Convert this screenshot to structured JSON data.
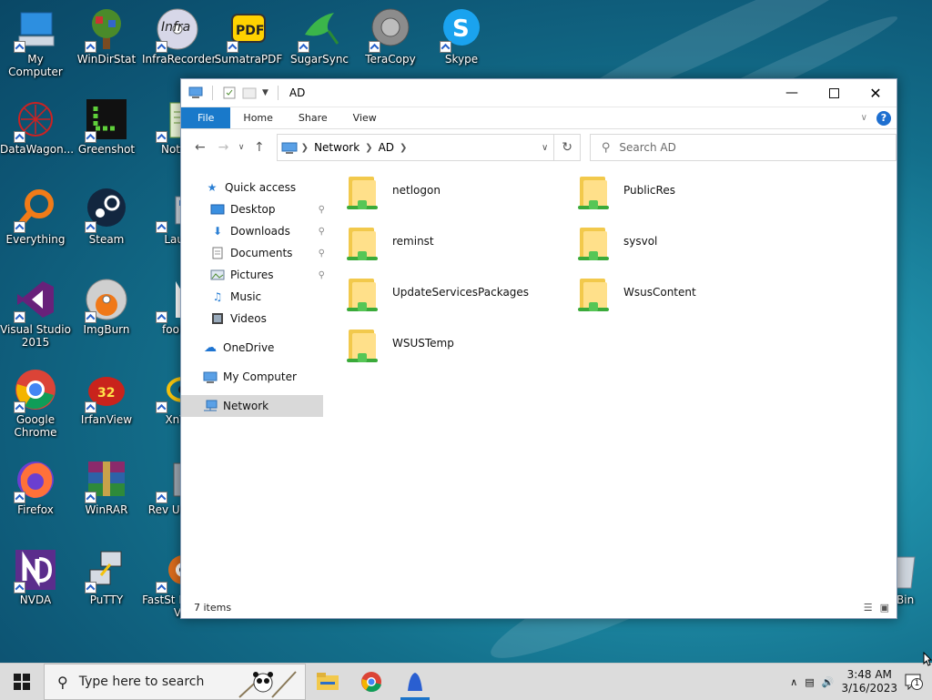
{
  "desktop": {
    "icons": [
      {
        "label": "My Computer"
      },
      {
        "label": "WinDirStat"
      },
      {
        "label": "InfraRecorder"
      },
      {
        "label": "SumatraPDF"
      },
      {
        "label": "SugarSync"
      },
      {
        "label": "TeraCopy"
      },
      {
        "label": "Skype"
      },
      {
        "label": "DataWagon..."
      },
      {
        "label": "Greenshot"
      },
      {
        "label": "Notep"
      },
      {
        "label": "Everything"
      },
      {
        "label": "Steam"
      },
      {
        "label": "Laun"
      },
      {
        "label": "Visual Studio 2015"
      },
      {
        "label": "ImgBurn"
      },
      {
        "label": "fooba"
      },
      {
        "label": "Google Chrome"
      },
      {
        "label": "IrfanView"
      },
      {
        "label": "XnVi"
      },
      {
        "label": "Firefox"
      },
      {
        "label": "WinRAR"
      },
      {
        "label": "Rev Uninst"
      },
      {
        "label": "NVDA"
      },
      {
        "label": "PuTTY"
      },
      {
        "label": "FastSt Image V"
      },
      {
        "label": "e Bin"
      }
    ],
    "irfanview_badge": "32",
    "sumatra_badge": "PDF",
    "skype_badge": "S",
    "infra_badge": "Infra"
  },
  "explorer": {
    "title": "AD",
    "ribbon_tabs": [
      "File",
      "Home",
      "Share",
      "View"
    ],
    "help": "?",
    "breadcrumb": [
      "Network",
      "AD"
    ],
    "search_placeholder": "Search AD",
    "nav": [
      {
        "label": "Quick access",
        "icon": "star-icon",
        "pinned": false
      },
      {
        "label": "Desktop",
        "icon": "desktop-icon",
        "pinned": true
      },
      {
        "label": "Downloads",
        "icon": "download-icon",
        "pinned": true
      },
      {
        "label": "Documents",
        "icon": "document-icon",
        "pinned": true
      },
      {
        "label": "Pictures",
        "icon": "picture-icon",
        "pinned": true
      },
      {
        "label": "Music",
        "icon": "music-icon",
        "pinned": false
      },
      {
        "label": "Videos",
        "icon": "video-icon",
        "pinned": false
      },
      {
        "label": "OneDrive",
        "icon": "cloud-icon",
        "pinned": false
      },
      {
        "label": "My Computer",
        "icon": "computer-icon",
        "pinned": false
      },
      {
        "label": "Network",
        "icon": "network-icon",
        "pinned": false,
        "selected": true
      }
    ],
    "items": [
      {
        "name": "netlogon"
      },
      {
        "name": "PublicRes"
      },
      {
        "name": "reminst"
      },
      {
        "name": "sysvol"
      },
      {
        "name": "UpdateServicesPackages"
      },
      {
        "name": "WsusContent"
      },
      {
        "name": "WSUSTemp"
      }
    ],
    "status": "7 items"
  },
  "taskbar": {
    "search_text": "Type here to search",
    "time": "3:48 AM",
    "date": "3/16/2023",
    "notification_count": "1"
  },
  "colors": {
    "accent": "#1979ca",
    "selected_nav": "#d9d9d9",
    "taskbar": "#dcdcdc"
  }
}
